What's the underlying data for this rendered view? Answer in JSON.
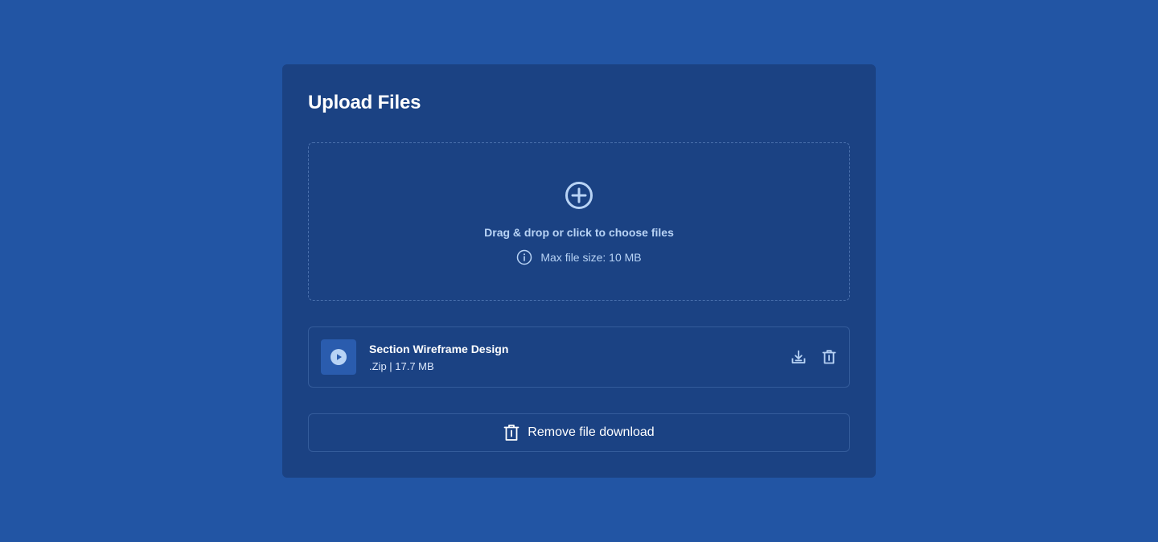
{
  "card": {
    "title": "Upload Files"
  },
  "dropzone": {
    "icon": "plus-circle-icon",
    "text": "Drag & drop or click to choose files",
    "hint_icon": "info-icon",
    "hint": "Max file size: 10 MB"
  },
  "file": {
    "icon": "play-icon",
    "name": "Section Wireframe Design",
    "meta": ".Zip | 17.7 MB",
    "actions": {
      "download_icon": "download-icon",
      "delete_icon": "trash-icon"
    }
  },
  "remove_button": {
    "icon": "trash-icon",
    "label": "Remove file download"
  },
  "colors": {
    "background": "#2255a4",
    "card": "#1b4283",
    "accent": "#b8d3f5"
  }
}
